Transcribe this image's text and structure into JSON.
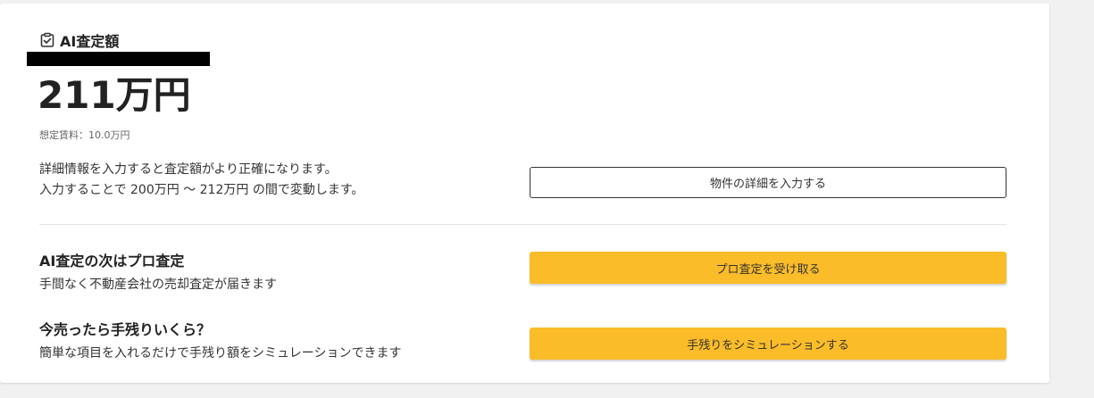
{
  "header": {
    "icon": "checkbox-checked-icon",
    "title": "AI査定額"
  },
  "estimate": {
    "price": "211万円",
    "rent_label": "想定賃料：10.0万円"
  },
  "details": {
    "line1": "詳細情報を入力すると査定額がより正確になります。",
    "line2": "入力することで 200万円 〜 212万円 の間で変動します。",
    "button_label": "物件の詳細を入力する"
  },
  "pro_assessment": {
    "title": "AI査定の次はプロ査定",
    "subtitle": "手間なく不動産会社の売却査定が届きます",
    "button_label": "プロ査定を受け取る"
  },
  "simulation": {
    "title": "今売ったら手残りいくら？",
    "subtitle": "簡単な項目を入れるだけで手残り額をシミュレーションできます",
    "button_label": "手残りをシミュレーションする"
  },
  "colors": {
    "accent_yellow": "#fbbc2a",
    "background": "#f1f1f1",
    "card": "#ffffff",
    "redaction": "#000000"
  }
}
